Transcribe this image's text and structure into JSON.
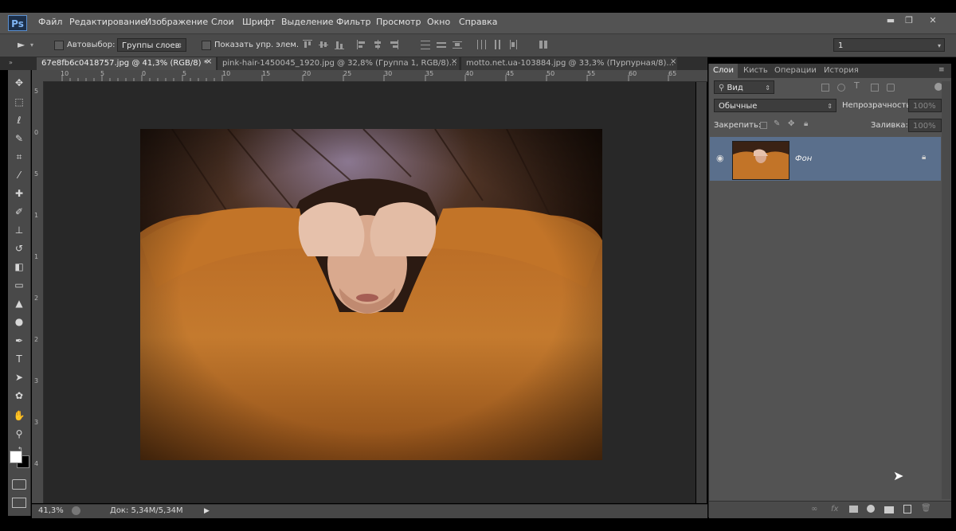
{
  "app": {
    "logo": "Ps"
  },
  "menu": [
    "Файл",
    "Редактирование",
    "Изображение",
    "Слои",
    "Шрифт",
    "Выделение",
    "Фильтр",
    "Просмотр",
    "Окно",
    "Справка"
  ],
  "window_controls": {
    "minimize": "▬",
    "restore": "❐",
    "close": "✕"
  },
  "options_bar": {
    "autoselect_label": "Автовыбор:",
    "autoselect_value": "Группы слоев",
    "show_controls_label": "Показать упр. элем.",
    "workspace_value": "1"
  },
  "tabs": [
    {
      "label": "67e8fb6c0418757.jpg @ 41,3% (RGB/8) *",
      "close": "×"
    },
    {
      "label": "pink-hair-1450045_1920.jpg @ 32,8% (Группа 1, RGB/8)...",
      "close": "×"
    },
    {
      "label": "motto.net.ua-103884.jpg @ 33,3% (Пурпурная/8)...",
      "close": "×"
    }
  ],
  "ruler_h": [
    "10",
    "5",
    "0",
    "5",
    "10",
    "15",
    "20",
    "25",
    "30",
    "35",
    "40",
    "45",
    "50",
    "55",
    "60",
    "65"
  ],
  "ruler_v": [
    "5",
    "0",
    "5",
    "1",
    "1",
    "2",
    "2",
    "3",
    "3",
    "4"
  ],
  "tools": [
    "move-icon",
    "marquee-icon",
    "lasso-icon",
    "quick-select-icon",
    "crop-icon",
    "eyedropper-icon",
    "healing-icon",
    "brush-icon",
    "stamp-icon",
    "history-brush-icon",
    "eraser-icon",
    "gradient-icon",
    "blur-icon",
    "dodge-icon",
    "pen-icon",
    "type-icon",
    "path-select-icon",
    "shape-icon",
    "hand-icon",
    "zoom-icon"
  ],
  "status": {
    "zoom": "41,3%",
    "doc": "Док: 5,34M/5,34M"
  },
  "panel": {
    "tabs": [
      "Слои",
      "Кисть",
      "Операции",
      "История"
    ],
    "filter_kind": "Вид",
    "blend_mode": "Обычные",
    "opacity_label": "Непрозрачность:",
    "opacity_value": "100%",
    "lock_label": "Закрепить:",
    "fill_label": "Заливка:",
    "fill_value": "100%",
    "layers": [
      {
        "name": "Фон",
        "locked": true,
        "visible": true
      }
    ]
  },
  "colors": {
    "accent": "#5a6f8c",
    "background": "#282828",
    "foreground_swatch": "#ffffff",
    "background_swatch": "#000000"
  }
}
